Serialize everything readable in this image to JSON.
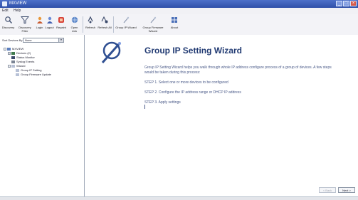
{
  "window": {
    "title": "MXVIEW"
  },
  "menu": {
    "items": [
      "Edit",
      "Help"
    ]
  },
  "toolbar": {
    "discovery": "Discovery",
    "discovery_filter": "Discovery Filter",
    "login": "Login",
    "logout": "Logout",
    "repaint": "Repaint",
    "open_link": "Open Link",
    "refresh": "Refresh",
    "refresh_all": "Refresh All",
    "group_ip_wizard": "Group IP Wizard",
    "group_firmware_wizard": "Group Firmware Wizard",
    "about": "About"
  },
  "sidebar": {
    "sort_label": "Sort Devices By",
    "sort_value": "None",
    "tree": [
      "MXVIEW",
      "Devices (2)",
      "Status Monitor",
      "Syslog Events",
      "Wizard",
      "Group IP Setting",
      "Group Firmware Update"
    ]
  },
  "wizard": {
    "title": "Group IP Setting Wizard",
    "intro": "Group IP Setting Wizard helps you walk through whole IP address configure process of a group of devices. A few steps would be taken during this process:",
    "step1": "STEP 1. Select one or more devices to be configured",
    "step2": "STEP 2. Configure the IP address range or DHCP IP address",
    "step3": "STEP 3. Apply settings",
    "back": "< Back",
    "next": "Next >"
  }
}
